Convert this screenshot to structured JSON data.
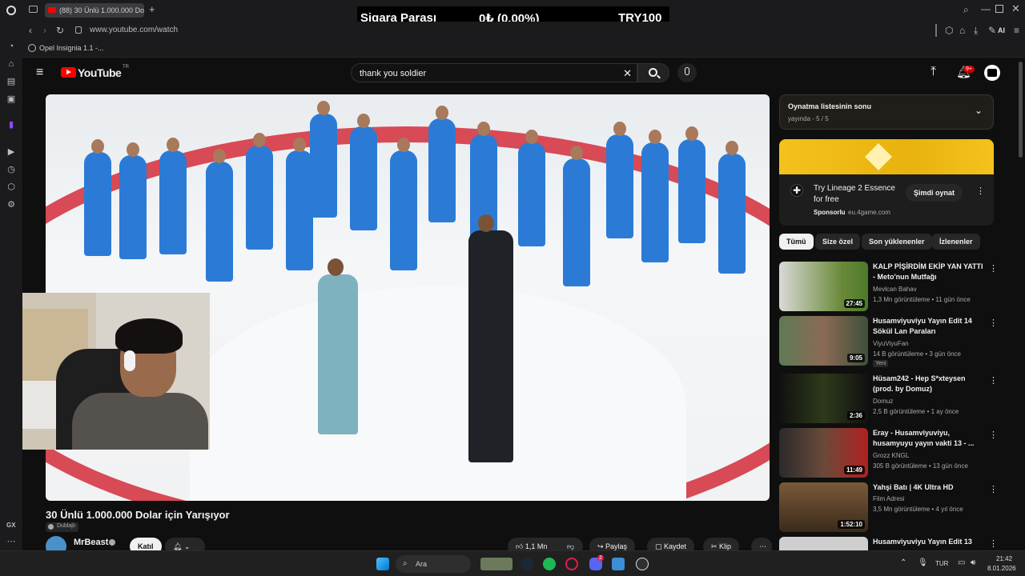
{
  "browser": {
    "tab_title": "(88) 30 Ünlü 1.000.000 Do",
    "url": "www.youtube.com/watch",
    "bookmark": "Opel Insignia 1.1 -...",
    "ai_label": "AI",
    "sidebar_label": "GX"
  },
  "ticker": {
    "label": "Sigara Parası",
    "amount": "0₺ (0.00%)",
    "goal": "TRY100"
  },
  "youtube": {
    "logo_text": "YouTube",
    "logo_region": "TR",
    "search_value": "thank you soldier",
    "notif_badge": "9+",
    "video": {
      "title": "30 Ünlü 1.000.000 Dolar için Yarışıyor",
      "dub_label": "Dublajlı",
      "channel": "MrBeast",
      "join_label": "Katıl",
      "like_count": "1,1 Mn",
      "share_label": "Paylaş",
      "save_label": "Kaydet",
      "clip_label": "Klip"
    },
    "playlist": {
      "title": "Oynatma listesinin sonu",
      "subtitle": "yayında - 5 / 5"
    },
    "ad": {
      "title": "Try Lineage 2 Essence for free",
      "sponsored": "Sponsorlu",
      "domain": "eu.4game.com",
      "cta": "Şimdi oynat"
    },
    "chips": [
      "Tümü",
      "Size özel",
      "Son yüklenenler",
      "İzlenenler"
    ],
    "recommendations": [
      {
        "title": "KALP PİŞİRDİM EKİP YAN YATTI - Meto'nun Mutfağı",
        "channel": "Mevlcan Bahav",
        "meta": "1,3 Mn görüntüleme • 11 gün önce",
        "duration": "27:45"
      },
      {
        "title": "Husamviyuviyu Yayın Edit 14 Sökül Lan Paraları",
        "channel": "ViyuViyuFan",
        "meta": "14 B görüntüleme • 3 gün önce",
        "duration": "9:05",
        "badge": "Yeni"
      },
      {
        "title": "Hüsam242 - Hep S*xteysen (prod. by Domuz)",
        "channel": "Domuz",
        "meta": "2,5 B görüntüleme • 1 ay önce",
        "duration": "2:36"
      },
      {
        "title": "Eray - Husamviyuviyu, husamyuyu yayın vakti 13 - ...",
        "channel": "Grozz KNGL",
        "meta": "305 B görüntüleme • 13 gün önce",
        "duration": "11:49"
      },
      {
        "title": "Yahşi Batı | 4K Ultra HD",
        "channel": "Film Adresi",
        "meta": "3,5 Mn görüntüleme • 4 yıl önce",
        "duration": "1:52:10"
      },
      {
        "title": "Husamviyuviyu Yayın Edit 13",
        "channel": "",
        "meta": "",
        "duration": ""
      }
    ]
  },
  "taskbar": {
    "search_placeholder": "Ara",
    "lang": "TUR",
    "time": "21:42",
    "date": "8.01.2026",
    "discord_badge": "2"
  },
  "colors": {
    "yt_red": "#ff0000",
    "bg": "#0f0f0f",
    "accent_blue": "#3ea6ff"
  }
}
